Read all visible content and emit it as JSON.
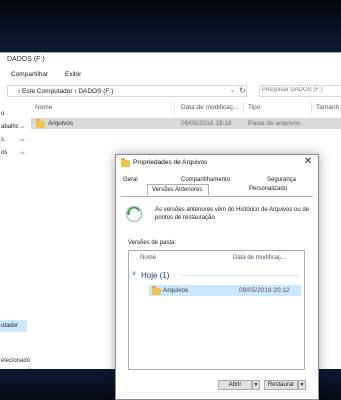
{
  "explorer": {
    "title": "DADOS (F:)",
    "ribbon_tabs": [
      "Compartilhar",
      "Exibir"
    ],
    "address": "›  Este Computador  ›  DADOS (F:)",
    "address_chevron": "⌄",
    "refresh": "↻",
    "search_placeholder": "Pesquisar DADOS (F:)",
    "nav_items": [
      "o",
      "abalhc",
      "s",
      "os"
    ],
    "nav_selected_item": "utador",
    "columns": [
      "Nome",
      "Data de modificaç...",
      "Tipo",
      "Tamanh"
    ],
    "files": [
      {
        "name": "Arquivos",
        "modified": "09/05/2018 18:16",
        "type": "Pasta de arquivos"
      }
    ],
    "status": "elecionado"
  },
  "dialog": {
    "title": "Propriedades de Arquivos",
    "close": "✕",
    "tabs_row1": [
      "Geral",
      "Compartilhamento",
      "Segurança"
    ],
    "tabs_row2": [
      "Versões Anteriores",
      "Personalizado"
    ],
    "active_tab": "Versões Anteriores",
    "info_text": "As versões anteriores vêm do Histórico de Arquivos ou de pontos de restauração",
    "versions_label": "Versões de pasta:",
    "list_columns": [
      "Nome",
      "Data de modificaç..."
    ],
    "group": "Hoje (1)",
    "group_chevron": "˅",
    "versions": [
      {
        "name": "Arquivos",
        "modified": "09/05/2018 20:12"
      }
    ],
    "open_button": "Abrir",
    "restore_button": "Restaurar",
    "arrow": "▼"
  },
  "colors": {
    "selection": "#cce8ff",
    "folder": "#f0c350",
    "background": "#0b1a33"
  }
}
